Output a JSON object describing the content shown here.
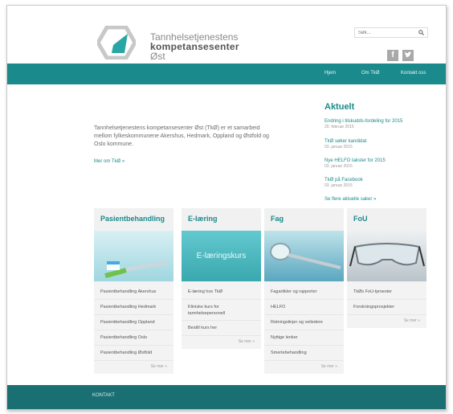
{
  "header": {
    "brand_line1": "Tannhelsetjenestens",
    "brand_line2": "kompetansesenter",
    "brand_line3": "Øst",
    "search_placeholder": "Søk..."
  },
  "nav": {
    "items": [
      "Hjem",
      "Om TkØ",
      "Kontakt oss"
    ]
  },
  "intro": {
    "text": "Tannhelsetjenestens kompetansesenter Øst (TkØ) er et samarbeid mellom fylkeskommunene Akershus, Hedmark, Oppland og Østfold og Oslo kommune.",
    "more_link": "Mer om TkØ »"
  },
  "news": {
    "heading": "Aktuelt",
    "items": [
      {
        "title": "Endring i tilskudds-fordeling for 2015",
        "date": "20. februar 2015"
      },
      {
        "title": "TkØ søker kandidat",
        "date": "03. januar 2015"
      },
      {
        "title": "Nye HELFO takster for 2015",
        "date": "03. januar 2015"
      },
      {
        "title": "TkØ på Facebook",
        "date": "03. januar 2015"
      }
    ],
    "all_link": "Se flere aktuelle saker »"
  },
  "columns": [
    {
      "title": "Pasientbehandling",
      "image_text": "",
      "items": [
        "Pasientbehandling Akershus",
        "Pasientbehandling Hedmark",
        "Pasientbehandling Oppland",
        "Pasientbehandling Oslo",
        "Pasientbehandling Østfold"
      ],
      "more": "Se mer »"
    },
    {
      "title": "E-læring",
      "image_text": "E-læringskurs",
      "items": [
        "E-læring hos TkØ",
        "Kliniske kurs for tannhelsepersonell",
        "Bestill kurs her"
      ],
      "more": "Se mer »"
    },
    {
      "title": "Fag",
      "image_text": "",
      "items": [
        "Fagartikler og rapporter",
        "HELFO",
        "Retningslinjer og veiledere",
        "Nyttige lenker",
        "Smertebehandling"
      ],
      "more": "Se mer »"
    },
    {
      "title": "FoU",
      "image_text": "",
      "items": [
        "TkØs FoU-tjenester",
        "Forskningsprosjekter"
      ],
      "more": "Se mer »"
    }
  ],
  "footer": {
    "label": "KONTAKT"
  },
  "colors": {
    "accent": "#1a8a8c",
    "footer": "#1a6f72"
  }
}
